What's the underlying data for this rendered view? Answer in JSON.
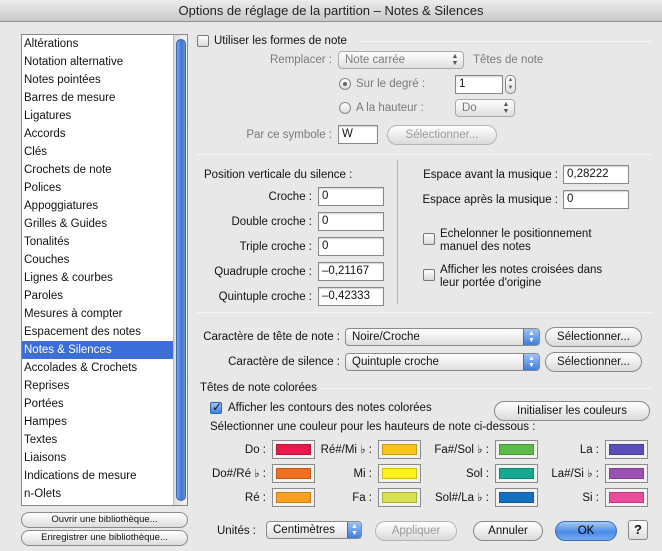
{
  "window": {
    "title": "Options de réglage de la partition – Notes & Silences"
  },
  "sidebar": {
    "items": [
      "Altérations",
      "Notation alternative",
      "Notes pointées",
      "Barres de mesure",
      "Ligatures",
      "Accords",
      "Clés",
      "Crochets de note",
      "Polices",
      "Appoggiatures",
      "Grilles & Guides",
      "Tonalités",
      "Couches",
      "Lignes & courbes",
      "Paroles",
      "Mesures à compter",
      "Espacement des notes",
      "Notes & Silences",
      "Accolades & Crochets",
      "Reprises",
      "Portées",
      "Hampes",
      "Textes",
      "Liaisons",
      "Indications de mesure",
      "n-Olets"
    ],
    "selected_index": 17,
    "open_library_label": "Ouvrir une bibliothèque...",
    "save_library_label": "Enregistrer une bibliothèque..."
  },
  "note_shapes": {
    "use_label": "Utiliser les formes de note",
    "use_checked": false,
    "replace_label": "Remplacer :",
    "replace_value": "Note carrée",
    "noteheads_label": "Têtes de note",
    "on_degree_label": "Sur le degré :",
    "on_degree_value": "1",
    "at_pitch_label": "A la hauteur :",
    "at_pitch_value": "Do",
    "by_symbol_label": "Par ce symbole :",
    "by_symbol_value": "W",
    "select_label": "Sélectionner..."
  },
  "rest_position": {
    "title": "Position verticale du silence :",
    "rows": [
      {
        "label": "Croche :",
        "value": "0"
      },
      {
        "label": "Double croche :",
        "value": "0"
      },
      {
        "label": "Triple croche :",
        "value": "0"
      },
      {
        "label": "Quadruple croche :",
        "value": "–0,21167"
      },
      {
        "label": "Quintuple croche :",
        "value": "–0,42333"
      }
    ]
  },
  "spacing": {
    "before_label": "Espace avant la musique :",
    "before_value": "0,28222",
    "after_label": "Espace après la musique :",
    "after_value": "0",
    "stagger_label_1": "Echelonner le positionnement",
    "stagger_label_2": "manuel des notes",
    "stagger_checked": false,
    "cross_label_1": "Afficher les notes croisées dans",
    "cross_label_2": "leur portée d'origine",
    "cross_checked": false
  },
  "characters": {
    "notehead_label": "Caractère de tête de note :",
    "notehead_value": "Noire/Croche",
    "rest_label": "Caractère de silence :",
    "rest_value": "Quintuple croche",
    "select_label": "Sélectionner..."
  },
  "colored": {
    "section_title": "Têtes de note colorées",
    "show_outline_label": "Afficher les contours des notes colorées",
    "show_outline_checked": true,
    "reset_label": "Initialiser les couleurs",
    "instruction": "Sélectionner une couleur pour les hauteurs de note ci-dessous :",
    "colors": [
      {
        "label": "Do :",
        "color": "#e8184a"
      },
      {
        "label": "Ré#/Mi ♭ :",
        "color": "#f8c418"
      },
      {
        "label": "Fa#/Sol ♭ :",
        "color": "#5dbb4a"
      },
      {
        "label": "La :",
        "color": "#5a4fb8"
      },
      {
        "label": "Do#/Ré ♭ :",
        "color": "#f07020"
      },
      {
        "label": "Mi :",
        "color": "#fff21c"
      },
      {
        "label": "Sol :",
        "color": "#16a890"
      },
      {
        "label": "La#/Si ♭ :",
        "color": "#9a52b2"
      },
      {
        "label": "Ré :",
        "color": "#f8a020"
      },
      {
        "label": "Fa :",
        "color": "#d8e050"
      },
      {
        "label": "Sol#/La ♭ :",
        "color": "#1670c0"
      },
      {
        "label": "Si :",
        "color": "#ec4a9a"
      }
    ]
  },
  "footer": {
    "units_label": "Unités :",
    "units_value": "Centimètres",
    "apply_label": "Appliquer",
    "cancel_label": "Annuler",
    "ok_label": "OK",
    "help_label": "?"
  }
}
